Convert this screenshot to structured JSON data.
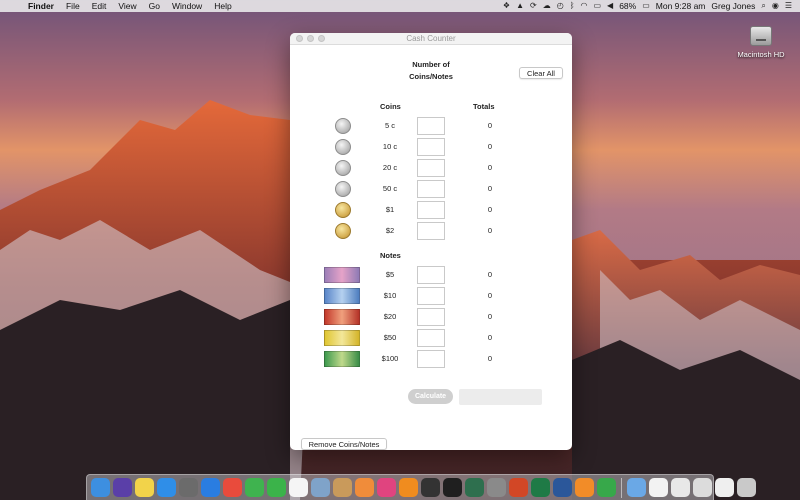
{
  "menubar": {
    "apple_icon": "apple-logo-icon",
    "app_name": "Finder",
    "items": [
      "File",
      "Edit",
      "View",
      "Go",
      "Window",
      "Help"
    ],
    "battery": "68%",
    "clock": "Mon 9:28 am",
    "user": "Greg Jones",
    "status_icons": [
      "dropbox-icon",
      "drive-icon",
      "sync-icon",
      "cloud-icon",
      "time-machine-icon",
      "bluetooth-icon",
      "wifi-icon",
      "airplay-icon",
      "volume-icon",
      "battery-icon",
      "search-icon",
      "siri-icon",
      "notification-list-icon"
    ]
  },
  "desktop": {
    "disk_label": "Macintosh HD"
  },
  "window": {
    "title": "Cash Counter",
    "header_number": "Number of Coins/Notes",
    "clear_all": "Clear All",
    "coins_heading": "Coins",
    "totals_heading": "Totals",
    "notes_heading": "Notes",
    "coins": [
      {
        "label": "5 c",
        "total": "0",
        "value": "",
        "metal": "silver"
      },
      {
        "label": "10 c",
        "total": "0",
        "value": "",
        "metal": "silver"
      },
      {
        "label": "20 c",
        "total": "0",
        "value": "",
        "metal": "silver"
      },
      {
        "label": "50 c",
        "total": "0",
        "value": "",
        "metal": "silver"
      },
      {
        "label": "$1",
        "total": "0",
        "value": "",
        "metal": "gold"
      },
      {
        "label": "$2",
        "total": "0",
        "value": "",
        "metal": "gold"
      }
    ],
    "notes": [
      {
        "label": "$5",
        "total": "0",
        "value": "",
        "color": "#9d7fb8"
      },
      {
        "label": "$10",
        "total": "0",
        "value": "",
        "color": "#5a86c9"
      },
      {
        "label": "$20",
        "total": "0",
        "value": "",
        "color": "#c43a2c"
      },
      {
        "label": "$50",
        "total": "0",
        "value": "",
        "color": "#e0c633"
      },
      {
        "label": "$100",
        "total": "0",
        "value": "",
        "color": "#3f9a4f"
      }
    ],
    "calculate": "Calculate",
    "result": "",
    "remove": "Remove Coins/Notes"
  },
  "dock": {
    "apps": [
      {
        "name": "finder-icon",
        "color": "#3d8fe0"
      },
      {
        "name": "siri-dock-icon",
        "color": "#5a3fa8"
      },
      {
        "name": "notes-icon",
        "color": "#f2d34a"
      },
      {
        "name": "app-store-icon",
        "color": "#2f8ee8"
      },
      {
        "name": "launchpad-icon",
        "color": "#6b6b6b"
      },
      {
        "name": "safari-icon",
        "color": "#2a7de1"
      },
      {
        "name": "chrome-icon",
        "color": "#e94b3c"
      },
      {
        "name": "messages-icon",
        "color": "#3fb34f"
      },
      {
        "name": "facetime-icon",
        "color": "#3bb34a"
      },
      {
        "name": "calendar-icon",
        "color": "#f5f5f5"
      },
      {
        "name": "photos-browser-icon",
        "color": "#7fa3c9"
      },
      {
        "name": "contacts-icon",
        "color": "#c99a5b"
      },
      {
        "name": "photos-icon",
        "color": "#f08c3a"
      },
      {
        "name": "itunes-icon",
        "color": "#e0447f"
      },
      {
        "name": "ibooks-icon",
        "color": "#f08c1f"
      },
      {
        "name": "final-cut-icon",
        "color": "#333333"
      },
      {
        "name": "terminal-icon",
        "color": "#1f1f1f"
      },
      {
        "name": "time-machine-dock-icon",
        "color": "#2e6f4e"
      },
      {
        "name": "system-preferences-icon",
        "color": "#8a8a8a"
      },
      {
        "name": "powerpoint-icon",
        "color": "#d24726"
      },
      {
        "name": "excel-icon",
        "color": "#1f7a46"
      },
      {
        "name": "word-icon",
        "color": "#2b579a"
      },
      {
        "name": "pages-icon",
        "color": "#f28c28"
      },
      {
        "name": "numbers-icon",
        "color": "#37a84a"
      },
      {
        "name": "downloads-folder-icon",
        "color": "#6aa8e6"
      },
      {
        "name": "document-icon",
        "color": "#f2f2f2"
      },
      {
        "name": "document-2-icon",
        "color": "#e8e8e8"
      },
      {
        "name": "document-3-icon",
        "color": "#dcdcdc"
      },
      {
        "name": "mail-icon",
        "color": "#efefef"
      },
      {
        "name": "trash-icon",
        "color": "#c9c9c9"
      }
    ]
  }
}
